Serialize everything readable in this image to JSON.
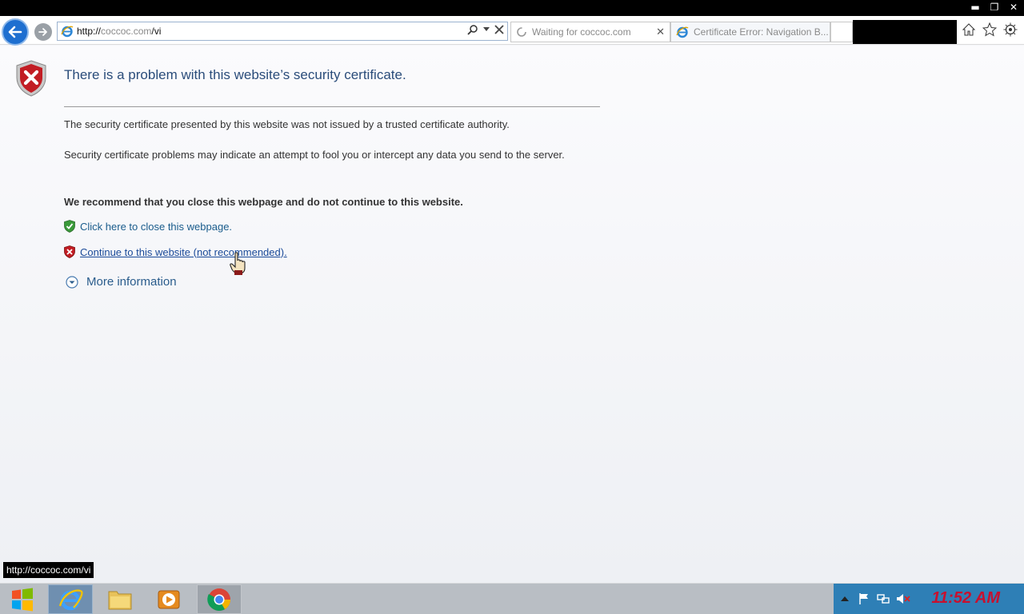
{
  "window": {
    "minimize_label": "▬",
    "restore_label": "❐",
    "close_label": "✕"
  },
  "navbar": {
    "address": {
      "prefix": "http://",
      "domain": "coccoc.com",
      "path": "/vi"
    },
    "tabs": [
      {
        "label": "Waiting for coccoc.com",
        "icon": "loading-spinner-icon"
      },
      {
        "label": "Certificate Error: Navigation B...",
        "icon": "ie-icon"
      }
    ],
    "toolbar": [
      "home-icon",
      "favorites-star-icon",
      "settings-gear-icon"
    ]
  },
  "page": {
    "heading": "There is a problem with this website’s security certificate.",
    "para1": "The security certificate presented by this website was not issued by a trusted certificate authority.",
    "para2": "Security certificate problems may indicate an attempt to fool you or intercept any data you send to the server.",
    "recommend": "We recommend that you close this webpage and do not continue to this website.",
    "close_link": "Click here to close this webpage.",
    "continue_link": "Continue to this website (not recommended).",
    "more_info": "More information"
  },
  "status_url": "http://coccoc.com/vi",
  "taskbar": {
    "items": [
      "start-icon",
      "ie-icon",
      "file-explorer-icon",
      "media-player-icon",
      "chrome-icon"
    ],
    "clock": "11:52 AM"
  },
  "colors": {
    "accent_blue": "#1e6fd0",
    "heading_blue": "#2a4c7a",
    "danger_red": "#c8102e",
    "tray_blue": "#2e7fb6"
  }
}
